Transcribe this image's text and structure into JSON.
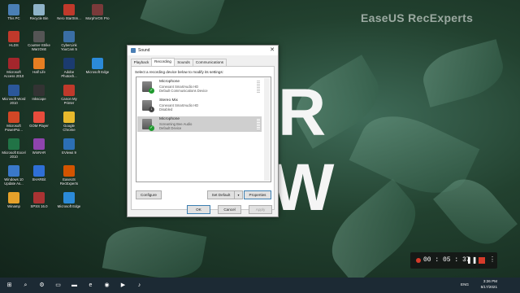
{
  "colors": {
    "accent": "#1f9a2e",
    "recording_red": "#d63b2a",
    "taskbar": "#1c2a34"
  },
  "watermark": "EaseUS RecExperts",
  "background_letters": [
    "R",
    "W"
  ],
  "desktop_icons": [
    {
      "label": "This PC",
      "icon": "this-pc-icon",
      "color": "#4a7fb5"
    },
    {
      "label": "Recycle Bin",
      "icon": "recycle-bin-icon",
      "color": "#8fb3c8"
    },
    {
      "label": "Nero StartSm...",
      "icon": "nero-icon",
      "color": "#c0392b"
    },
    {
      "label": "MorphVOX Pro",
      "icon": "morphvox-icon",
      "color": "#7a3a3a"
    },
    {
      "label": "HLDS",
      "icon": "hlds-icon",
      "color": "#c0392b"
    },
    {
      "label": "Counter-Strike WarzOnE",
      "icon": "counter-strike-icon",
      "color": "#555"
    },
    {
      "label": "CyberLink YouCam 5",
      "icon": "youcam-icon",
      "color": "#3a6ea5"
    },
    {
      "label": "Microsoft Access 2010",
      "icon": "access-icon",
      "color": "#a4262c"
    },
    {
      "label": "Half Life",
      "icon": "half-life-icon",
      "color": "#e67e22"
    },
    {
      "label": "Adobe Photosh...",
      "icon": "photoshop-icon",
      "color": "#1b3b6f"
    },
    {
      "label": "Microsoft Edge",
      "icon": "edge-icon",
      "color": "#2b8ad8"
    },
    {
      "label": "Microsoft Word 2010",
      "icon": "word-icon",
      "color": "#2b579a"
    },
    {
      "label": "Inkscape",
      "icon": "inkscape-icon",
      "color": "#333"
    },
    {
      "label": "Canon My Printer",
      "icon": "canon-icon",
      "color": "#c0392b"
    },
    {
      "label": "Microsoft PowerPoi...",
      "icon": "powerpoint-icon",
      "color": "#d24726"
    },
    {
      "label": "GOM Player",
      "icon": "gom-player-icon",
      "color": "#e74c3c"
    },
    {
      "label": "Google Chrome",
      "icon": "chrome-icon",
      "color": "#e8b92c"
    },
    {
      "label": "Microsoft Excel 2010",
      "icon": "excel-icon",
      "color": "#217346"
    },
    {
      "label": "WinRAR",
      "icon": "winrar-icon",
      "color": "#8e44ad"
    },
    {
      "label": "EViews 9",
      "icon": "eviews-icon",
      "color": "#2c6fb5"
    },
    {
      "label": "Windows 10 Update As...",
      "icon": "windows-update-icon",
      "color": "#3a78c9"
    },
    {
      "label": "SHAREit",
      "icon": "shareit-icon",
      "color": "#2f6fd6"
    },
    {
      "label": "EaseUS RecExperts",
      "icon": "recexperts-icon",
      "color": "#d35400"
    },
    {
      "label": "Winamp",
      "icon": "winamp-icon",
      "color": "#e6a12a"
    },
    {
      "label": "SPSS 16.0",
      "icon": "spss-icon",
      "color": "#a33"
    },
    {
      "label": "Microsoft Edge",
      "icon": "edge-icon",
      "color": "#2b8ad8"
    }
  ],
  "dialog": {
    "title": "Sound",
    "close": "✕",
    "tabs": [
      "Playback",
      "Recording",
      "Sounds",
      "Communications"
    ],
    "active_tab": "Recording",
    "instruction": "Select a recording device below to modify its settings:",
    "devices": [
      {
        "name": "Microphone",
        "driver": "Conexant SmartAudio HD",
        "status": "Default Communications Device",
        "badge": "✓",
        "badge_type": "ok"
      },
      {
        "name": "Stereo Mix",
        "driver": "Conexant SmartAudio HD",
        "status": "Disabled",
        "badge": "↓",
        "badge_type": "down"
      },
      {
        "name": "Microphone",
        "driver": "Screaming Bee Audio",
        "status": "Default Device",
        "badge": "✓",
        "badge_type": "ok"
      }
    ],
    "selected_device_index": 2,
    "buttons": {
      "configure": "Configure",
      "set_default": "Set Default",
      "set_default_arrow": "▾",
      "properties": "Properties",
      "ok": "OK",
      "cancel": "Cancel",
      "apply": "Apply"
    }
  },
  "recorder": {
    "time": "00 : 05 : 37",
    "pause": "❚❚",
    "more": "⋮"
  },
  "taskbar": {
    "items": [
      {
        "icon": "start-icon",
        "glyph": "⊞"
      },
      {
        "icon": "search-icon",
        "glyph": "⌕"
      },
      {
        "icon": "settings-icon",
        "glyph": "⚙"
      },
      {
        "icon": "task-view-icon",
        "glyph": "▭"
      },
      {
        "icon": "file-explorer-icon",
        "glyph": "▬"
      },
      {
        "icon": "edge-icon",
        "glyph": "e"
      },
      {
        "icon": "chrome-icon",
        "glyph": "◉"
      },
      {
        "icon": "media-icon",
        "glyph": "▶"
      },
      {
        "icon": "sound-app-icon",
        "glyph": "♪"
      }
    ],
    "language": "ENG",
    "time": "3:26 PM",
    "date": "5/17/2021"
  }
}
